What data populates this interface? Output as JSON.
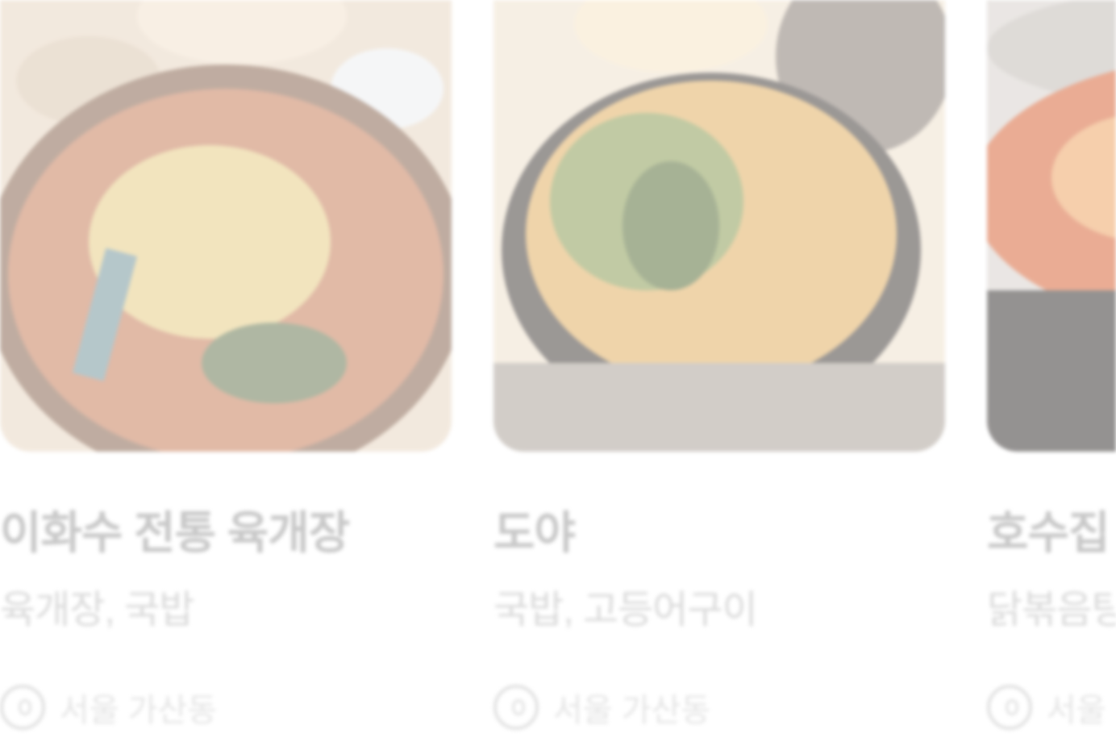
{
  "cards": [
    {
      "title": "이화수 전통 육개장",
      "subtitle": "육개장, 국밥",
      "meta_icon": "location-pin-icon",
      "meta_text": "서울 가산동"
    },
    {
      "title": "도야",
      "subtitle": "국밥, 고등어구이",
      "meta_icon": "location-pin-icon",
      "meta_text": "서울 가산동"
    },
    {
      "title": "호수집",
      "subtitle": "닭볶음탕",
      "meta_icon": "location-pin-icon",
      "meta_text": "서울 가산동"
    }
  ],
  "colors": {
    "title": "#9a9a9a",
    "subtitle": "#bcbcbc",
    "meta": "#cfcfcf"
  }
}
